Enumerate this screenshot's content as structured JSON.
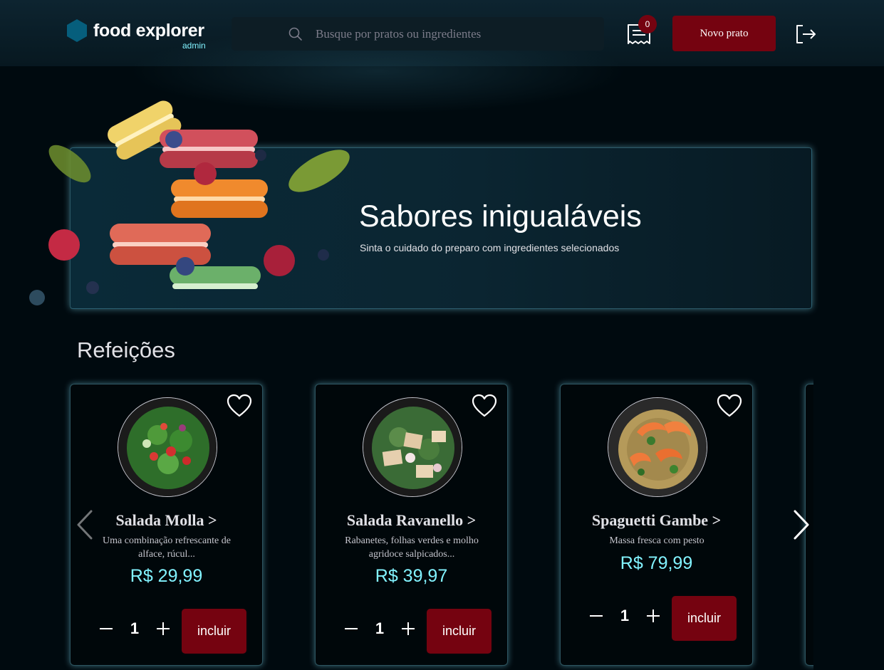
{
  "header": {
    "brand": "food explorer",
    "brand_sub": "admin",
    "search_placeholder": "Busque por pratos ou ingredientes",
    "orders_count": "0",
    "new_dish_label": "Novo prato"
  },
  "hero": {
    "title": "Sabores inigualáveis",
    "subtitle": "Sinta o cuidado do preparo com ingredientes selecionados"
  },
  "section": {
    "title": "Refeições"
  },
  "dishes": [
    {
      "name": "Salada Molla >",
      "description": "Uma combinação refrescante de alface, rúcul...",
      "price": "R$ 29,99",
      "quantity": "1",
      "add_label": "incluir"
    },
    {
      "name": "Salada Ravanello >",
      "description": "Rabanetes, folhas verdes e molho agridoce salpicados...",
      "price": "R$ 39,97",
      "quantity": "1",
      "add_label": "incluir"
    },
    {
      "name": "Spaguetti Gambe >",
      "description": "Massa fresca com pesto",
      "price": "R$ 79,99",
      "quantity": "1",
      "add_label": "incluir"
    }
  ],
  "colors": {
    "accent": "#82f3ff",
    "brand_red": "#750310",
    "background": "#000a0f",
    "header_bg": "#0d2430"
  },
  "icons": {
    "logo": "hexagon-logo-icon",
    "search": "search-icon",
    "orders": "receipt-icon",
    "logout": "sign-out-icon",
    "favorite": "heart-icon",
    "carousel_prev": "chevron-left-icon",
    "carousel_next": "chevron-right-icon"
  }
}
